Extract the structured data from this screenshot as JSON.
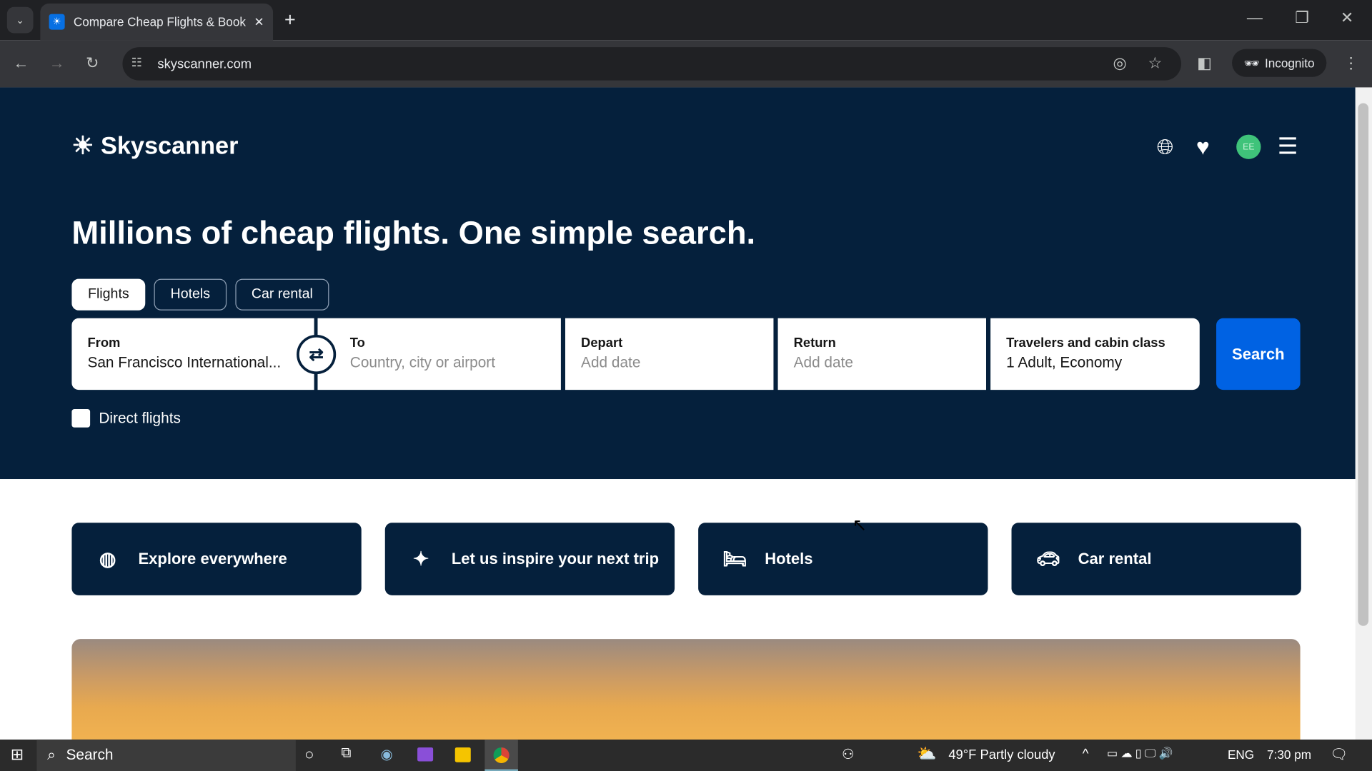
{
  "browser": {
    "tab_title": "Compare Cheap Flights & Book",
    "url": "skyscanner.com",
    "incognito_label": "Incognito"
  },
  "header": {
    "logo": "Skyscanner",
    "avatar_initials": "EE"
  },
  "hero": {
    "headline": "Millions of cheap flights. One simple search.",
    "tabs": [
      {
        "label": "Flights",
        "active": true
      },
      {
        "label": "Hotels"
      },
      {
        "label": "Car rental"
      }
    ],
    "from": {
      "label": "From",
      "value": "San Francisco International..."
    },
    "to": {
      "label": "To",
      "placeholder": "Country, city or airport"
    },
    "depart": {
      "label": "Depart",
      "placeholder": "Add date"
    },
    "return": {
      "label": "Return",
      "placeholder": "Add date"
    },
    "travelers": {
      "label": "Travelers and cabin class",
      "value": "1 Adult, Economy"
    },
    "search_label": "Search",
    "direct_flights": {
      "label": "Direct flights",
      "checked": false
    }
  },
  "cards": [
    {
      "label": "Explore everywhere",
      "icon": "globe-icon"
    },
    {
      "label": "Let us inspire your next trip",
      "icon": "sparkle-icon"
    },
    {
      "label": "Hotels",
      "icon": "bed-icon"
    },
    {
      "label": "Car rental",
      "icon": "car-icon"
    }
  ],
  "taskbar": {
    "search": "Search",
    "weather": "49°F  Partly cloudy",
    "lang": "ENG",
    "time": "7:30 pm"
  },
  "colors": {
    "navy": "#05203c",
    "accent": "#0062e3",
    "avatar": "#3fc37a"
  }
}
